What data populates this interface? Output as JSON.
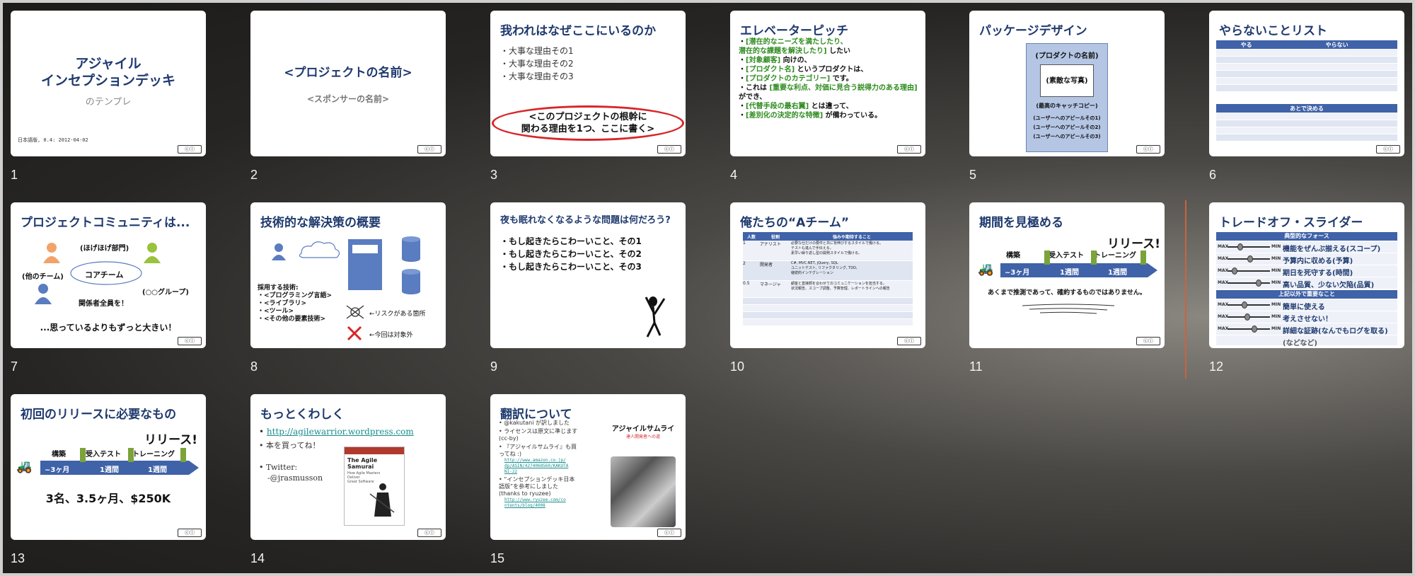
{
  "slides": [
    {
      "number": "1",
      "title": "アジャイル\nインセプションデッキ",
      "subtitle": "のテンプレ",
      "footer": "日本語版, 0.4: 2012-04-02"
    },
    {
      "number": "2",
      "title": "<プロジェクトの名前>",
      "subtitle": "<スポンサーの名前>"
    },
    {
      "number": "3",
      "title": "我われはなぜここにいるのか",
      "bullets": [
        "・大事な理由その1",
        "・大事な理由その2",
        "・大事な理由その3"
      ],
      "callout": "<このプロジェクトの根幹に\n関わる理由を1つ、ここに書く>"
    },
    {
      "number": "4",
      "title": "エレベーターピッチ",
      "lines": [
        [
          "[潜在的なニーズを満たしたり、\n 潜在的な課題を解決したり]",
          "したい"
        ],
        [
          "[対象顧客]",
          "向けの、"
        ],
        [
          "[プロダクト名]",
          "というプロダクトは、"
        ],
        [
          "[プロダクトのカテゴリー]",
          "です。"
        ],
        [
          "これは",
          "[重要な利点、対価に見合う説得力のある理由]",
          "ができ、"
        ],
        [
          "[代替手段の最右翼]",
          "とは違って、"
        ],
        [
          "[差別化の決定的な特徴]",
          "が備わっている。"
        ]
      ]
    },
    {
      "number": "5",
      "title": "パッケージデザイン",
      "box_title": "(プロダクトの名前)",
      "photo": "(素敵な写真)",
      "catch": "(最高のキャッチコピー)",
      "appeals": [
        "(ユーザーへのアピールその1)",
        "(ユーザーへのアピールその2)",
        "(ユーザーへのアピールその3)"
      ]
    },
    {
      "number": "6",
      "title": "やらないことリスト",
      "col_do": "やる",
      "col_dont": "やらない",
      "later": "あとで決める"
    },
    {
      "number": "7",
      "title": "プロジェクトコミュニティは...",
      "labels": {
        "dept": "(ほげほげ部門)",
        "other": "(他のチーム)",
        "core": "コアチーム",
        "group": "(○○グループ)",
        "all": "関係者全員を！",
        "more": "...思っているよりもずっと大きい！"
      }
    },
    {
      "number": "8",
      "title": "技術的な解決策の概要",
      "tech_head": "採用する技術:",
      "tech_items": [
        "・<プログラミング言語>",
        "・<ライブラリ>",
        "・<ツール>",
        "・<その他の要素技術>"
      ],
      "risk": "←リスクがある箇所",
      "out": "←今回は対象外"
    },
    {
      "number": "9",
      "title": "夜も眠れなくなるような問題は何だろう?",
      "bullets": [
        "・もし起きたらこわーいこと、その1",
        "・もし起きたらこわーいこと、その2",
        "・もし起きたらこわーいこと、その3"
      ]
    },
    {
      "number": "10",
      "title": "俺たちの“Aチーム”",
      "headers": [
        "人数",
        "役割",
        "強みや期待すること"
      ],
      "rows": [
        [
          "1",
          "アナリスト",
          "必要な仕だけの要件と共に背伸びするスタイルで働ける。\nテストも進んで手伝える。\n素早い繰り返し型の開発スタイルで働ける。"
        ],
        [
          "2",
          "開発者",
          "C#, MVC.NET, jQuery, SQL\nユニットテスト, リファクタリング, TDD,\n継続的インテグレーション"
        ],
        [
          "0.5",
          "マネージャ",
          "顧客と直接顔を合わせてのコミュニケーションを担当する。\n状況報告、スコープ調整、予算管理、レポートラインへの報告"
        ]
      ]
    },
    {
      "number": "11",
      "title": "期間を見極める",
      "release": "リリース!",
      "phases": [
        "構築",
        "受入テスト",
        "トレーニング"
      ],
      "durations": [
        "~3ヶ月",
        "1週間",
        "1週間"
      ],
      "note": "あくまで推測であって、確約するものではありません。"
    },
    {
      "number": "12",
      "title": "トレードオフ・スライダー",
      "forces_head": "典型的なフォース",
      "forces": [
        "機能をぜんぶ揃える(スコープ)",
        "予算内に収める(予算)",
        "期日を死守する(時間)",
        "高い品質、少ない欠陥(品質)"
      ],
      "other_head": "上記以外で重要なこと",
      "others": [
        "簡単に使える",
        "考えさせない！",
        "詳細な証跡(なんでもログを取る)",
        "(などなど)"
      ],
      "max": "MAX",
      "min": "MIN"
    },
    {
      "number": "13",
      "title": "初回のリリースに必要なもの",
      "release": "リリース!",
      "phases": [
        "構築",
        "受入テスト",
        "トレーニング"
      ],
      "durations": [
        "~3ヶ月",
        "1週間",
        "1週間"
      ],
      "summary": "3名、3.5ヶ月、$250K"
    },
    {
      "number": "14",
      "title": "もっとくわしく",
      "link": "http://agilewarrior.wordpress.com",
      "buy": "本を買ってね！",
      "twitter": "Twitter:",
      "handle": "-@jrasmusson",
      "book_title": "The Agile Samurai",
      "book_sub": "How Agile Masters\nDeliver\nGreat Software"
    },
    {
      "number": "15",
      "title": "翻訳について",
      "items": [
        "@kakutani が訳しました",
        "ライセンスは原文に準じます\n(cc-by)",
        "『アジャイルサムライ』も買\nってね :)",
        "“インセプションデッキ日本\n語版”を参考にしました\n(thanks to ryuzee)"
      ],
      "sub1": "http://www.amazon.co.jp/\ndp/ASIN/4274068560/KAKUTA\nNI-22",
      "sub2": "http://www.ryuzee.com/co\nntents/blog/4008",
      "book_jp": "アジャイルサムライ",
      "book_jp_sub": "達人開発者への道"
    }
  ],
  "colors": {
    "accent": "#1f3a6e",
    "green": "#2e8b1e",
    "table_blue": "#3f62a8",
    "selection": "#c8643c"
  }
}
